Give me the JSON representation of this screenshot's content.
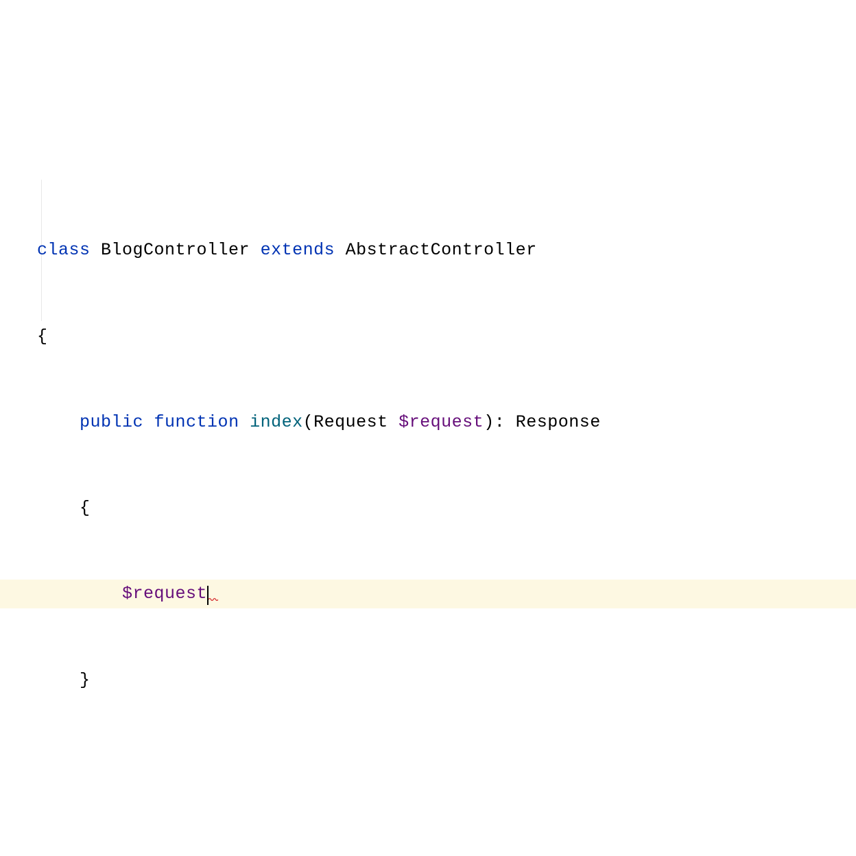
{
  "code": {
    "line1": {
      "kw_class": "class",
      "class_name": " BlogController ",
      "kw_extends": "extends",
      "parent_class": " AbstractController"
    },
    "line2": {
      "brace": "{"
    },
    "line3": {
      "indent": "    ",
      "kw_public": "public",
      "sp1": " ",
      "kw_function": "function",
      "sp2": " ",
      "fn_name": "index",
      "paren_open": "(",
      "param_type": "Request ",
      "param_var": "$request",
      "paren_close": ")",
      "colon": ": ",
      "return_type": "Response"
    },
    "line4": {
      "indent": "    ",
      "brace": "{"
    },
    "line5": {
      "indent": "        ",
      "var": "$request"
    },
    "line6": {
      "indent": "    ",
      "brace": "}"
    }
  }
}
